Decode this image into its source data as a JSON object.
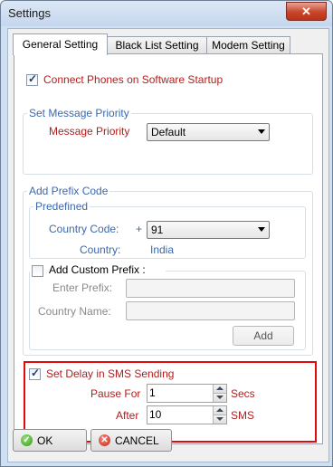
{
  "window": {
    "title": "Settings",
    "close_glyph": "✕"
  },
  "tabs": [
    {
      "label": "General Setting",
      "active": true
    },
    {
      "label": "Black List Setting",
      "active": false
    },
    {
      "label": "Modem Setting",
      "active": false
    }
  ],
  "general": {
    "connect_label": "Connect Phones on Software Startup",
    "connect_checked": true,
    "priority_group": {
      "legend": "Set Message Priority",
      "label": "Message Priority",
      "value": "Default"
    },
    "prefix_group": {
      "legend": "Add Prefix Code",
      "predefined": {
        "legend": "Predefined",
        "country_code_label": "Country Code:",
        "plus_sign": "+",
        "country_code_value": "91",
        "country_label": "Country:",
        "country_value": "India"
      },
      "custom": {
        "label": "Add Custom Prefix :",
        "checked": false,
        "enter_prefix_label": "Enter Prefix:",
        "enter_prefix_value": "",
        "country_name_label": "Country Name:",
        "country_name_value": "",
        "add_button": "Add"
      }
    },
    "delay": {
      "label": "Set Delay in SMS Sending",
      "checked": true,
      "pause_label": "Pause For",
      "pause_value": "1",
      "pause_unit": "Secs",
      "after_label": "After",
      "after_value": "10",
      "after_unit": "SMS"
    }
  },
  "footer": {
    "ok": "OK",
    "cancel": "CANCEL"
  },
  "icons": {
    "ok": "check-circle-icon",
    "cancel": "x-circle-icon",
    "checkbox": "check-mark"
  }
}
